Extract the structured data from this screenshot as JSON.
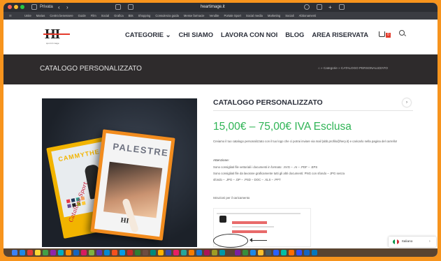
{
  "browser": {
    "tab_label": "Privata",
    "url": "heartimage.it"
  },
  "bookmarks": [
    "Unite",
    "Marias",
    "Centro benessere",
    "Guide",
    "Film",
    "Social",
    "Grafica",
    "Bits",
    "Shopping",
    "Consulenza guida",
    "Messe farmacie",
    "Vendite",
    "Portale Sport",
    "Social media",
    "Marketing",
    "Sociali",
    "Abbonamenti"
  ],
  "site": {
    "logo_text": "HI",
    "logo_tagline": "sport & image",
    "nav": [
      "CATEGORIE ⌄",
      "CHI SIAMO",
      "LAVORA CON NOI",
      "BLOG",
      "AREA RISERVATA"
    ],
    "cart_count": "0"
  },
  "page": {
    "title": "CATALOGO PERSONALIZZATO",
    "breadcrumb": "⌂ » Categorie » CATALOGO PERSONALIZZATO"
  },
  "product": {
    "catalog_back_word": "CAMMYTHEA",
    "catalog_back_script": "Catalogo Sport",
    "catalog_front_word": "PALESTRE",
    "catalog_front_logo": "HI",
    "title": "CATALOGO PERSONALIZZATO",
    "price": "15,00€ – 75,00€ IVA Esclusa",
    "description": "Creiamo il tuo catalogo personalizzato con il tuo logo che ci potrai inviare via mail (abb.profilo@hery.it) e caricarlo nella pagina del carrello!",
    "attention_heading": "Attenzione:",
    "attention_lines": [
      "Sono consigliati file vettoriali i documenti in formato: .SVG – .AI – .PDF – .EPS",
      "Sono consigliati file da lavorare graficamente tutti gli altri documenti: PNG con sfondo – JPG senza",
      "sfondo – .JPG – .DP – .PSD – DOC – .XLS – .PPT"
    ],
    "instructions": "Istruzioni per il caricamento"
  },
  "language": {
    "label": "Italiano",
    "chevron": "›"
  },
  "colors": {
    "accent_orange": "#f7941d",
    "price_green": "#2fb455",
    "title_bar": "#2e2b2c",
    "badge_red": "#e43b2c"
  }
}
